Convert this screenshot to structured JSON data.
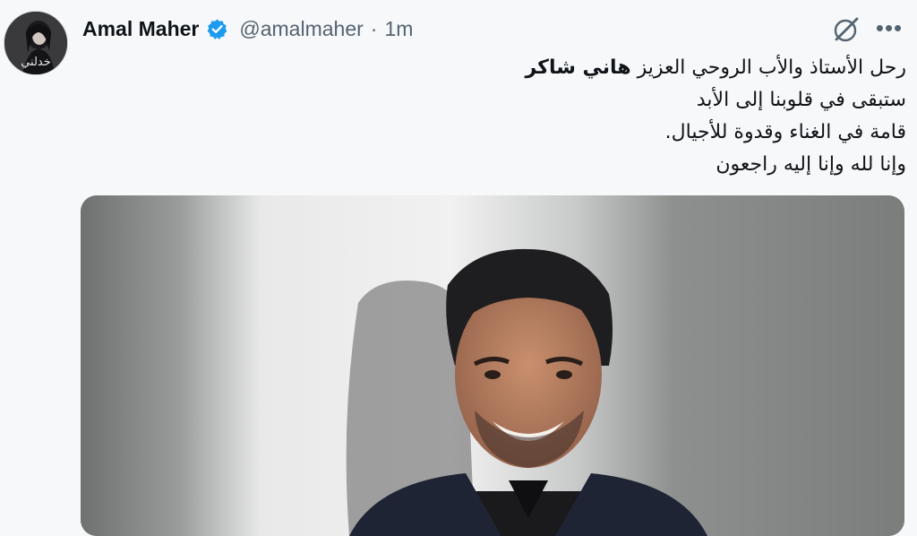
{
  "author": {
    "display_name": "Amal Maher",
    "handle": "@amalmaher",
    "separator": "·",
    "time": "1m",
    "avatar_text": "خدلني"
  },
  "actions": {
    "grok_icon": "grok-icon",
    "more_label": "•••"
  },
  "tweet": {
    "line1_before": "رحل الأستاذ والأب الروحي العزيز ",
    "line1_bold": "هاني شاكر",
    "line2": "ستبقى في قلوبنا إلى الأبد",
    "line3": "قامة في الغناء وقدوة للأجيال.",
    "line4": "وإنا لله وإنا إليه راجعون"
  },
  "colors": {
    "verified": "#1d9bf0",
    "secondary_text": "#536471",
    "primary_text": "#0f1419"
  }
}
